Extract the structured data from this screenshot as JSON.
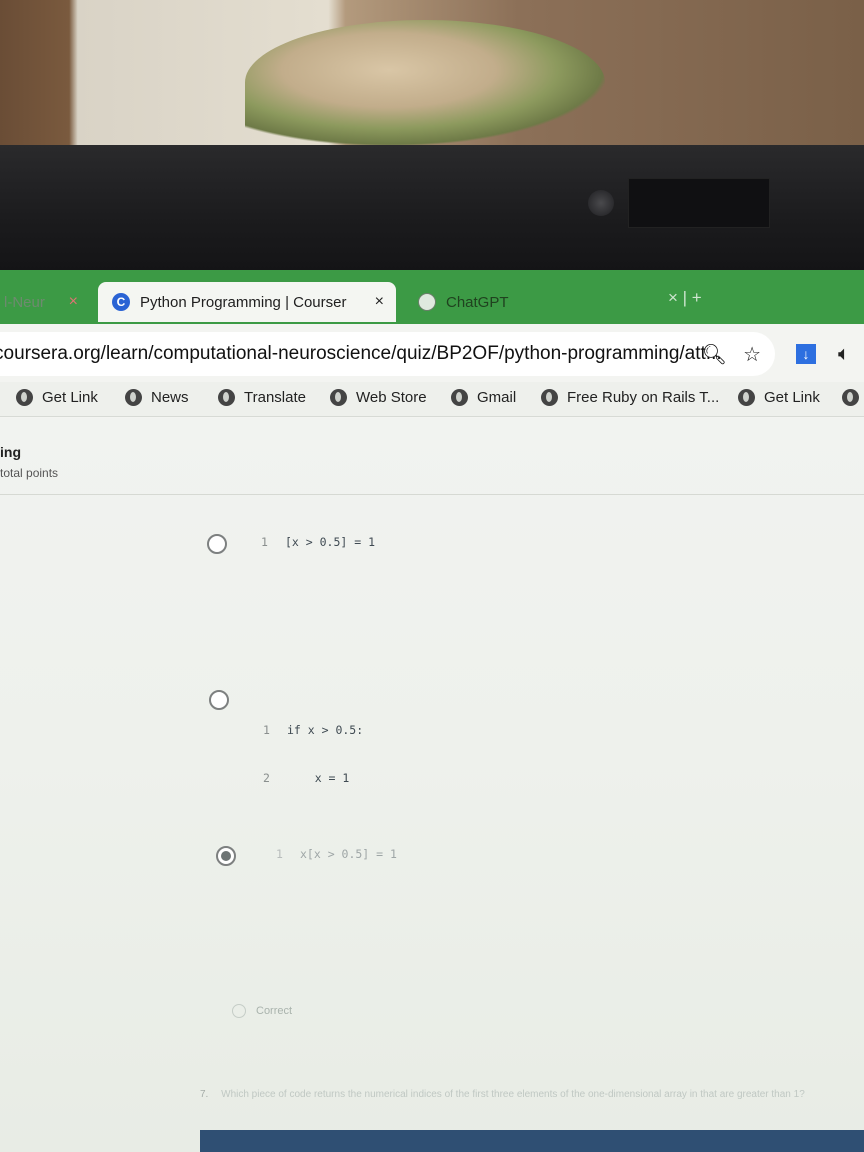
{
  "browser": {
    "tabs": [
      {
        "label": "l-Neur",
        "close": "×"
      },
      {
        "label": "Python Programming | Courser",
        "close": "×",
        "favicon": "C"
      },
      {
        "label": "ChatGPT"
      }
    ],
    "tab_controls": "× | +",
    "address": "coursera.org/learn/computational-neuroscience/quiz/BP2OF/python-programming/att...",
    "bookmarks": [
      "Get Link",
      "News",
      "Translate",
      "Web Store",
      "Gmail",
      "Free Ruby on Rails T...",
      "Get Link"
    ]
  },
  "quiz": {
    "title": "ing",
    "points": "total points",
    "options": [
      {
        "lines": [
          {
            "n": "1",
            "code": "[x > 0.5] = 1"
          }
        ],
        "selected": false
      },
      {
        "lines": [
          {
            "n": "1",
            "code": "if x > 0.5:"
          },
          {
            "n": "2",
            "code": "    x = 1"
          }
        ],
        "selected": false
      },
      {
        "lines": [
          {
            "n": "1",
            "code": "x[x > 0.5] = 1"
          }
        ],
        "selected": true
      }
    ],
    "feedback": "Correct",
    "next_question": {
      "number": "7.",
      "text": "Which piece of code returns the numerical indices of the first three elements of the one-dimensional array in that are greater than 1?"
    }
  },
  "colors": {
    "tabbar": "#3c9a45",
    "accent": "#2a63d4"
  }
}
